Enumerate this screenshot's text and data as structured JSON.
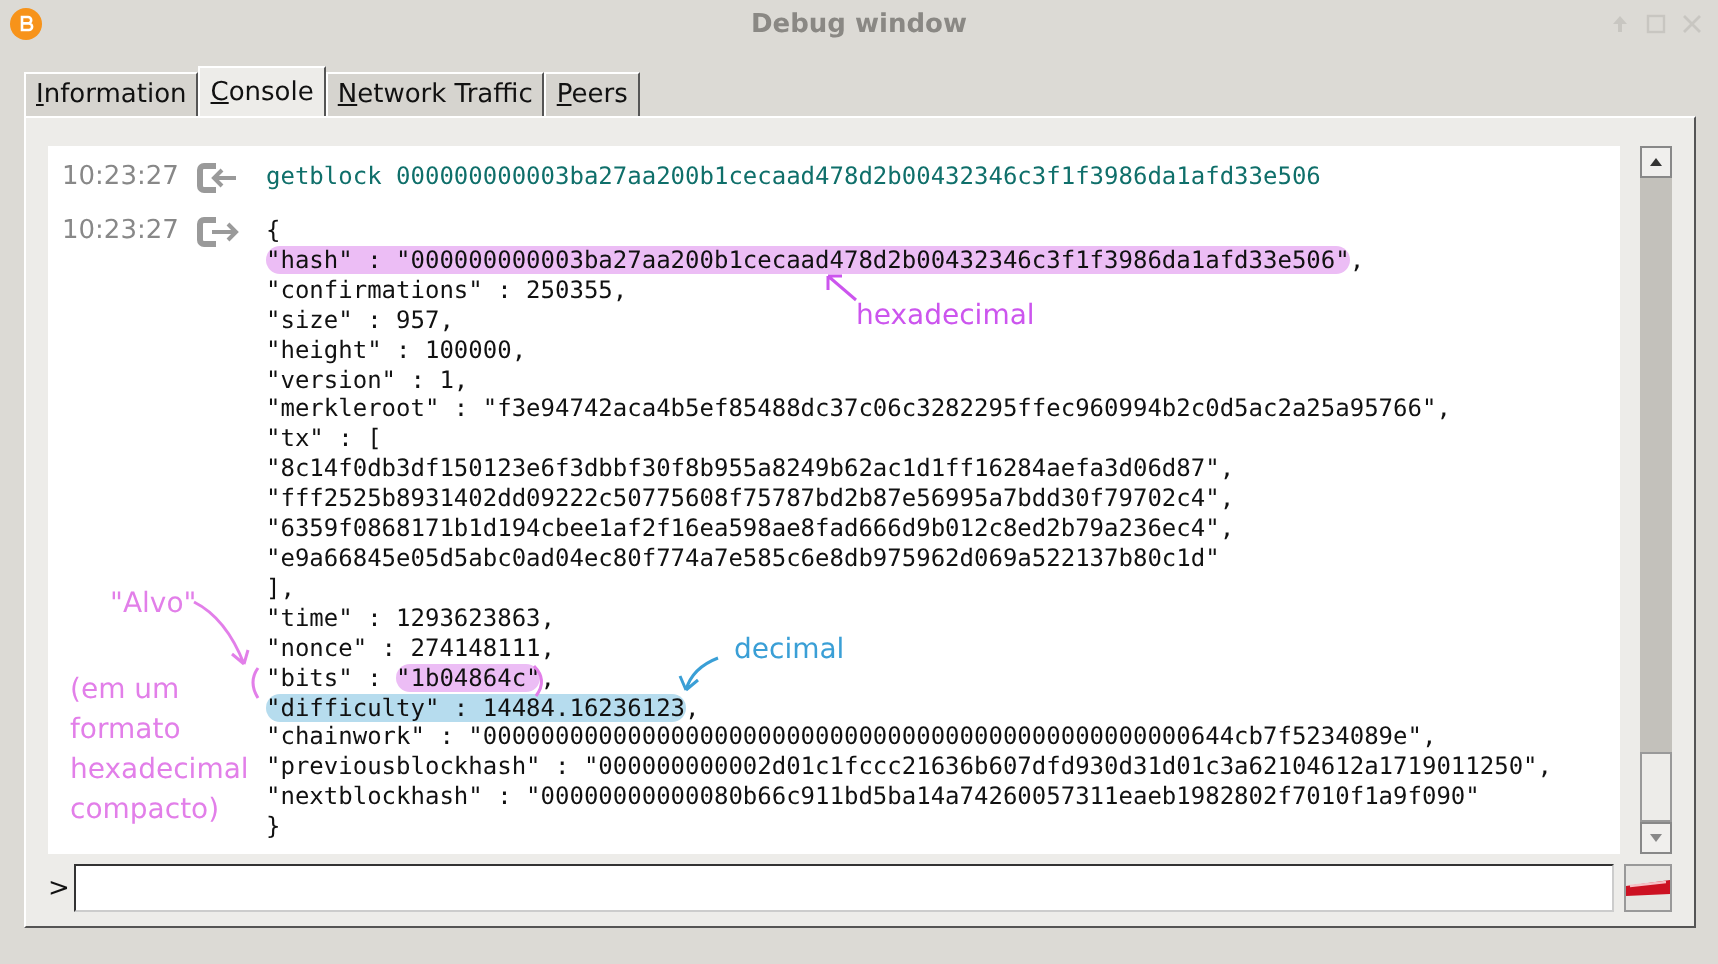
{
  "window": {
    "title": "Debug window"
  },
  "prompt": ">",
  "tabs": [
    {
      "label": "Information",
      "selected": false
    },
    {
      "label": "Console",
      "selected": true
    },
    {
      "label": "Network Traffic",
      "selected": false
    },
    {
      "label": "Peers",
      "selected": false
    }
  ],
  "console": {
    "entries": [
      {
        "kind": "command",
        "time": "10:23:27",
        "lines": [
          [
            {
              "text": "getblock 000000000003ba27aa200b1cecaad478d2b00432346c3f1f3986da1afd33e506"
            }
          ]
        ]
      },
      {
        "kind": "reply",
        "time": "10:23:27",
        "lines": [
          [
            {
              "text": "{"
            }
          ],
          [
            {
              "text": "\"hash\" : \"000000000003ba27aa200b1cecaad478d2b00432346c3f1f3986da1afd33e506\"",
              "color": "#ecbdf5"
            },
            {
              "text": ","
            }
          ],
          [
            {
              "text": "\"confirmations\" : 250355,"
            }
          ],
          [
            {
              "text": "\"size\" : 957,"
            }
          ],
          [
            {
              "text": "\"height\" : 100000,"
            }
          ],
          [
            {
              "text": "\"version\" : 1,"
            }
          ],
          [
            {
              "text": "\"merkleroot\" : \"f3e94742aca4b5ef85488dc37c06c3282295ffec960994b2c0d5ac2a25a95766\","
            }
          ],
          [
            {
              "text": "\"tx\" : ["
            }
          ],
          [
            {
              "text": "\"8c14f0db3df150123e6f3dbbf30f8b955a8249b62ac1d1ff16284aefa3d06d87\","
            }
          ],
          [
            {
              "text": "\"fff2525b8931402dd09222c50775608f75787bd2b87e56995a7bdd30f79702c4\","
            }
          ],
          [
            {
              "text": "\"6359f0868171b1d194cbee1af2f16ea598ae8fad666d9b012c8ed2b79a236ec4\","
            }
          ],
          [
            {
              "text": "\"e9a66845e05d5abc0ad04ec80f774a7e585c6e8db975962d069a522137b80c1d\""
            }
          ],
          [
            {
              "text": "],"
            }
          ],
          [
            {
              "text": "\"time\" : 1293623863,"
            }
          ],
          [
            {
              "text": "\"nonce\" : 274148111,"
            }
          ],
          [
            {
              "text": "\"bits\" : "
            },
            {
              "text": "\"1b04864c\"",
              "color": "#ecbdf5"
            },
            {
              "text": ","
            }
          ],
          [
            {
              "text": "\"difficulty\" : 14484.16236123",
              "color": "#b6dcee"
            },
            {
              "text": ","
            }
          ],
          [
            {
              "text": "\"chainwork\" : \"0000000000000000000000000000000000000000000000000644cb7f5234089e\","
            }
          ],
          [
            {
              "text": "\"previousblockhash\" : \"000000000002d01c1fccc21636b607dfd930d31d01c3a62104612a1719011250\","
            }
          ],
          [
            {
              "text": "\"nextblockhash\" : \"00000000000080b66c911bd5ba14a74260057311eaeb1982802f7010f1a9f090\""
            }
          ],
          [
            {
              "text": "}"
            }
          ]
        ]
      }
    ]
  },
  "annotations": [
    {
      "text": "hexadecimal",
      "color": "#cc55ee"
    },
    {
      "text": "decimal",
      "color": "#3a9fd6"
    },
    {
      "text": "\"Alvo\"",
      "color": "#e27fe9"
    },
    {
      "text": "(em um formato hexadecimal compacto)",
      "color": "#e27fe9"
    }
  ]
}
